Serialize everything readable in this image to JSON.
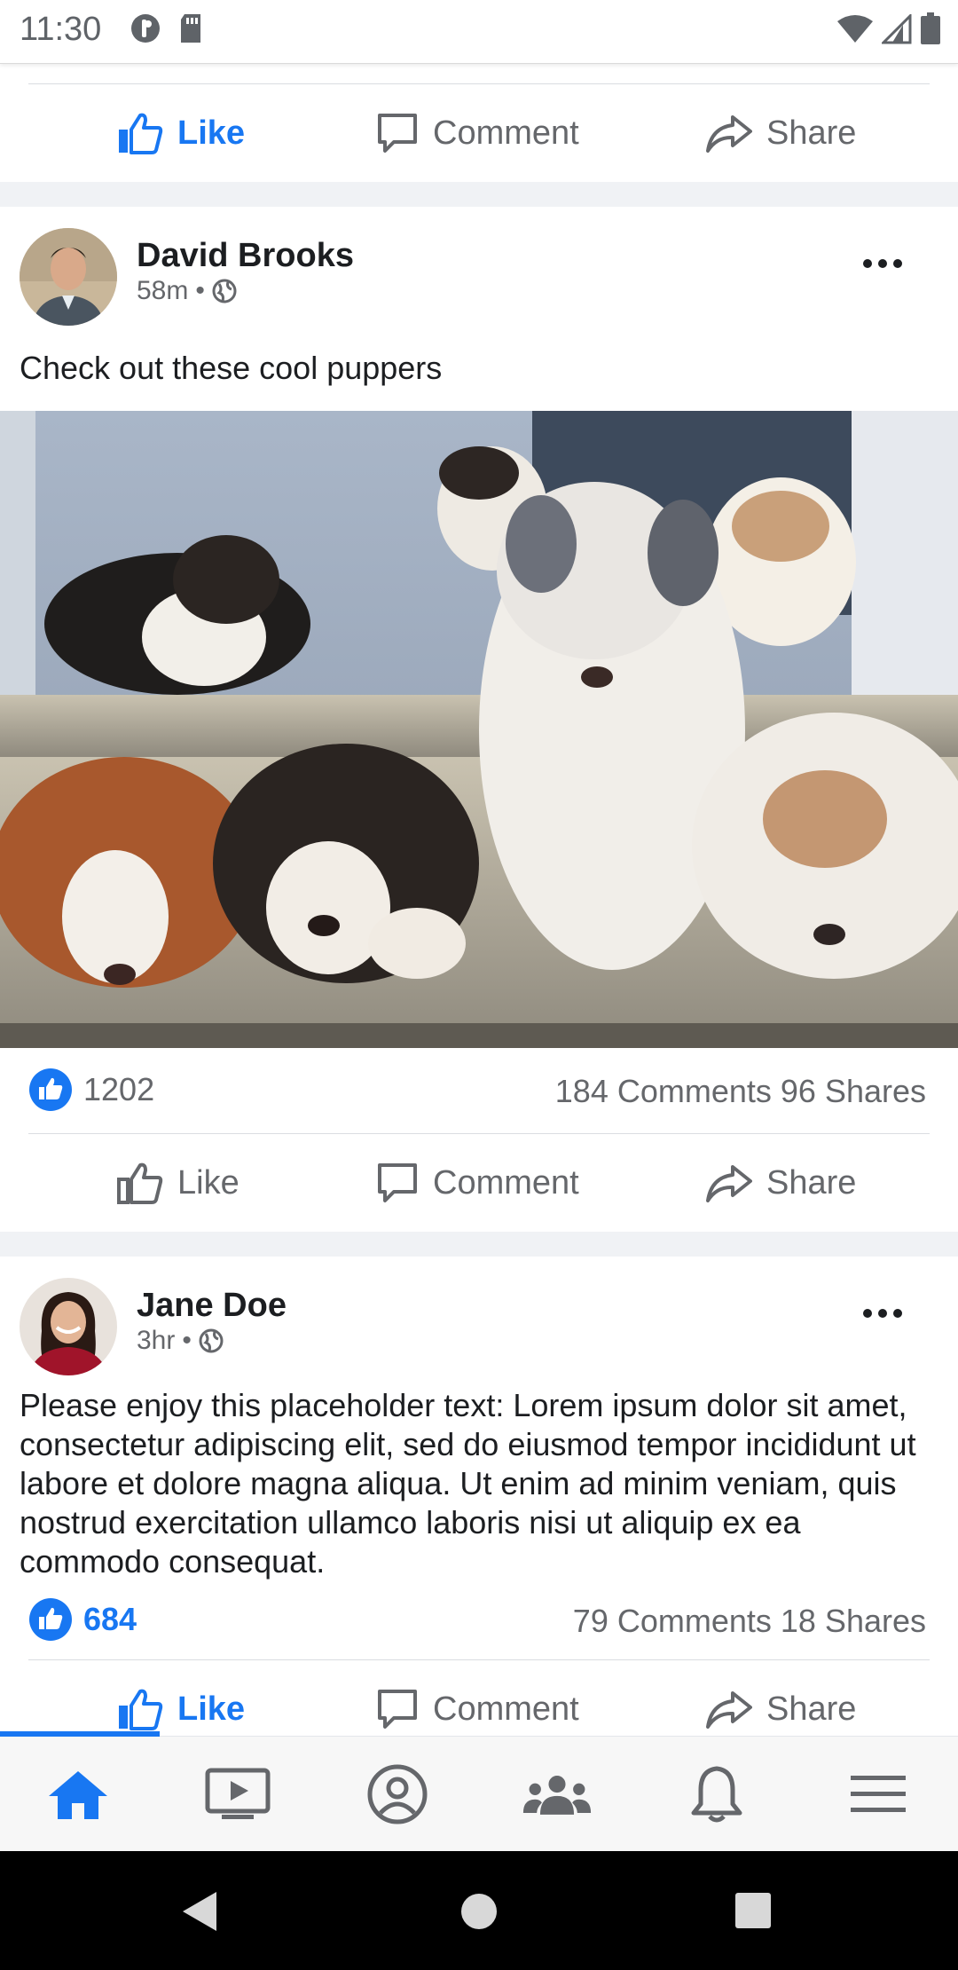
{
  "status_bar": {
    "time": "11:30"
  },
  "actions": {
    "like": "Like",
    "comment": "Comment",
    "share": "Share"
  },
  "posts": [
    {
      "author": "David Brooks",
      "time": "58m",
      "text": "Check out these cool puppers",
      "likes": "1202",
      "comments_shares": "184 Comments 96 Shares"
    },
    {
      "author": "Jane Doe",
      "time": "3hr",
      "text": "Please enjoy this placeholder text: Lorem ipsum dolor sit amet, consectetur adipiscing elit, sed do eiusmod tempor incididunt ut labore et dolore magna aliqua. Ut enim ad minim veniam, quis nostrud exercitation ullamco laboris nisi ut aliquip ex ea commodo consequat.",
      "likes": "684",
      "comments_shares": "79 Comments 18 Shares"
    }
  ],
  "nav": {
    "selected": "home"
  },
  "colors": {
    "accent": "#1877f2",
    "muted": "#65676b",
    "separator": "#f0f2f5"
  },
  "icons": [
    "like-icon",
    "comment-icon",
    "share-icon",
    "globe-icon",
    "more-icon",
    "home-icon",
    "watch-icon",
    "profile-icon",
    "groups-icon",
    "notifications-icon",
    "menu-icon"
  ]
}
